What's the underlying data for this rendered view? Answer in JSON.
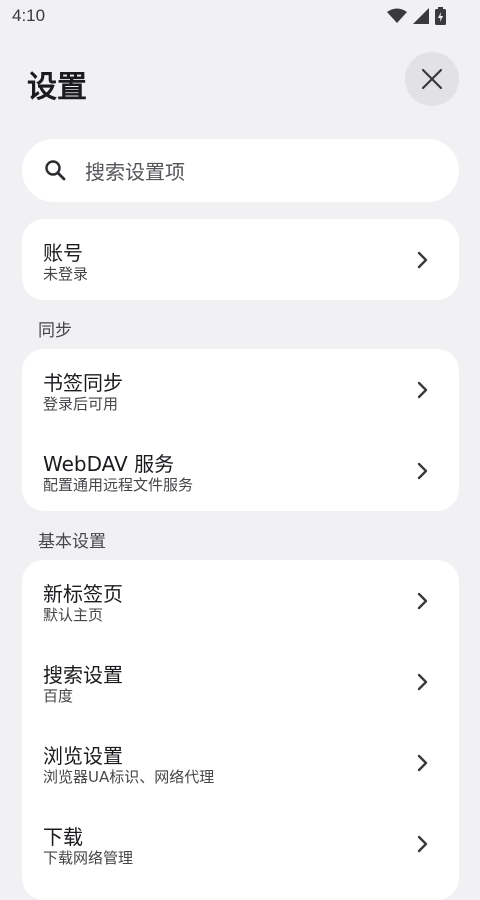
{
  "status_bar": {
    "time": "4:10"
  },
  "header": {
    "title": "设置"
  },
  "search": {
    "placeholder": "搜索设置项"
  },
  "account": {
    "title": "账号",
    "subtitle": "未登录"
  },
  "sections": {
    "sync": "同步",
    "basic": "基本设置"
  },
  "sync_items": [
    {
      "title": "书签同步",
      "subtitle": "登录后可用"
    },
    {
      "title": "WebDAV 服务",
      "subtitle": "配置通用远程文件服务"
    }
  ],
  "basic_items": [
    {
      "title": "新标签页",
      "subtitle": "默认主页"
    },
    {
      "title": "搜索设置",
      "subtitle": "百度"
    },
    {
      "title": "浏览设置",
      "subtitle": "浏览器UA标识、网络代理"
    },
    {
      "title": "下载",
      "subtitle": "下载网络管理"
    }
  ],
  "colors": {
    "background": "#f1f1f4",
    "card": "#ffffff",
    "close_button_bg": "#e2e2e6"
  },
  "icons": [
    "wifi-icon",
    "signal-icon",
    "battery-charging-icon",
    "close-icon",
    "search-icon",
    "chevron-right-icon"
  ]
}
